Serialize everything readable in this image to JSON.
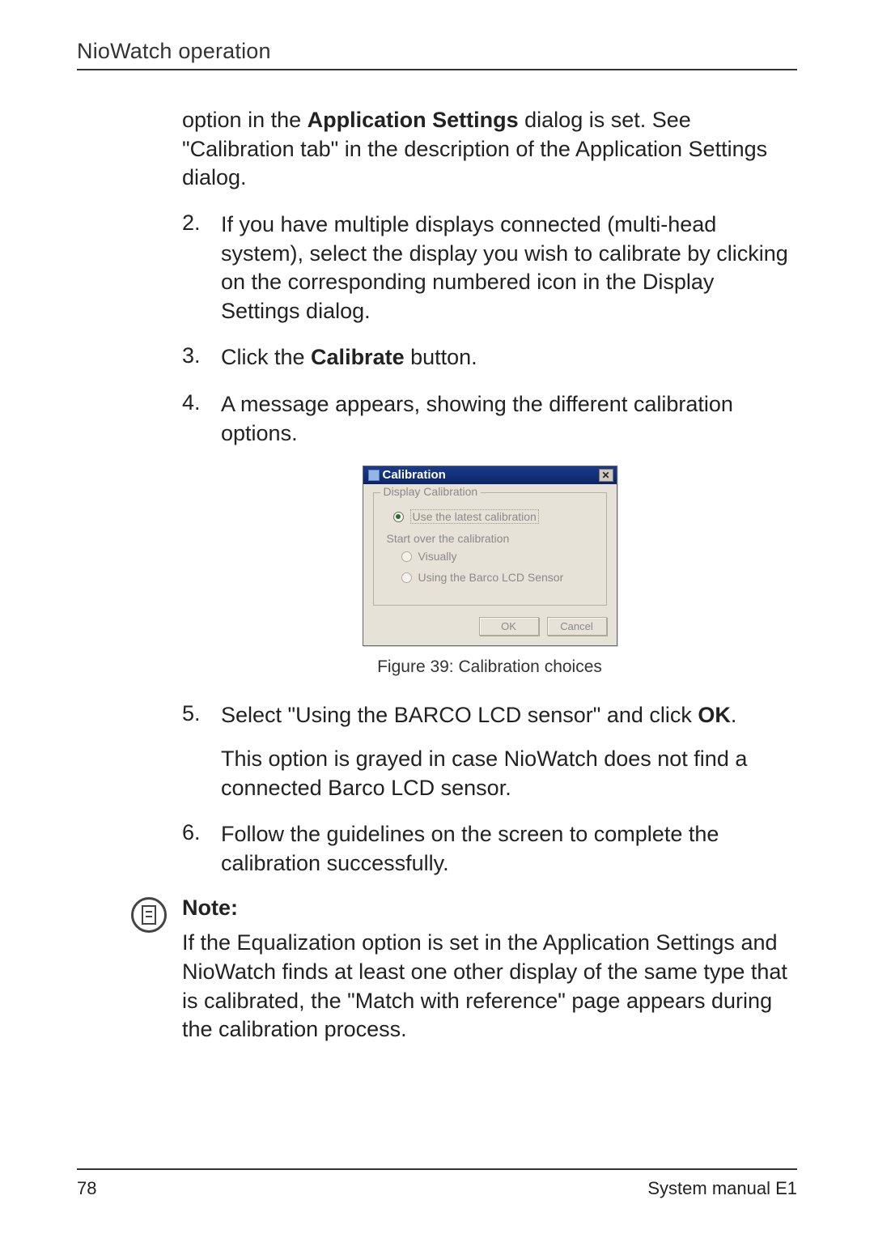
{
  "header": {
    "running_head": "NioWatch operation"
  },
  "intro_para": {
    "pre": "option in the ",
    "strong": "Application Settings",
    "post": " dialog is set. See \"Calibration tab\" in the description of the Application Settings dialog."
  },
  "steps": {
    "s2": {
      "num": "2.",
      "text": "If you have multiple displays connected (multi-head system), select the display you wish to calibrate by clicking on the corresponding numbered icon in the Display Settings dialog."
    },
    "s3": {
      "num": "3.",
      "pre": "Click the ",
      "strong": "Calibrate",
      "post": " button."
    },
    "s4": {
      "num": "4.",
      "text": "A message appears, showing the different calibration options."
    },
    "s5": {
      "num": "5.",
      "pre": "Select \"Using the BARCO LCD sensor\" and click ",
      "strong": "OK",
      "post": ".",
      "extra": "This option is grayed in case NioWatch does not find a connected Barco LCD sensor."
    },
    "s6": {
      "num": "6.",
      "text": "Follow the guidelines on the screen to complete the calibration successfully."
    }
  },
  "dialog": {
    "title": "Calibration",
    "group_legend": "Display Calibration",
    "opt_latest": "Use the latest calibration",
    "subhead": "Start over the calibration",
    "opt_visually": "Visually",
    "opt_barco": "Using the Barco LCD Sensor",
    "btn_ok": "OK",
    "btn_cancel": "Cancel",
    "close_glyph": "✕"
  },
  "figure_caption": "Figure 39: Calibration choices",
  "note": {
    "title": "Note:",
    "body": "If the Equalization option is set in the Application Settings and NioWatch finds at least one other display of the same type that is calibrated, the \"Match with reference\" page appears during the calibration process."
  },
  "footer": {
    "page": "78",
    "doc": "System manual E1"
  }
}
